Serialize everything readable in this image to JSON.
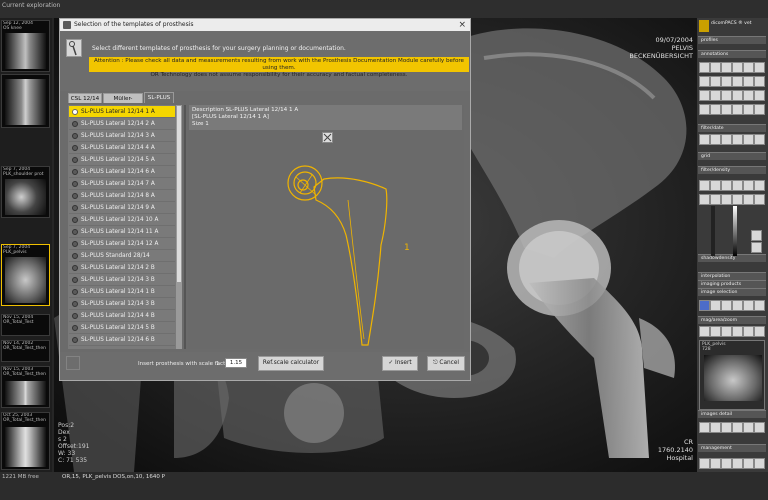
{
  "app": {
    "left_top_label": "Current exploration"
  },
  "thumbs": [
    {
      "caption": "Sep 12, 2004\nOS knee",
      "id": "knee"
    },
    {
      "caption": "",
      "id": "knee2"
    },
    {
      "caption": "Sep 7, 2004\nPLK_shoulder prot",
      "id": "shoulder"
    },
    {
      "caption": "Sep 7, 2004\nPLK_pelvis",
      "id": "pelvis"
    },
    {
      "caption": "Nov 15, 2004\nOR_Total_Test",
      "id": "t1"
    },
    {
      "caption": "Nov 14, 2002\nOR_Total_Test_then",
      "id": "t2"
    },
    {
      "caption": "Nov 15, 2003\nOR_Total_Test_then",
      "id": "t3"
    },
    {
      "caption": "Oct 25, 2003\nOR_Total_Test_then",
      "id": "t4"
    }
  ],
  "xray_overlay": {
    "top_right": [
      "09/07/2004",
      "PELVIS",
      "BECKENÜBERSICHT"
    ],
    "bottom_left": [
      "Pos:2",
      "Dex",
      "s 2",
      "Offset:191",
      "W: 33",
      "C: 71 535"
    ],
    "bottom_right": [
      "CR",
      "1760.2140",
      "Hospital"
    ]
  },
  "right_panel": {
    "header": "dicomPACS ® vet",
    "sections": [
      "profiles",
      "annotations",
      "filter/date",
      "grid",
      "filter/density",
      "shadowdensity",
      "interpolation",
      "imaging products",
      "image selection",
      "mag/area/zoom",
      "images detail",
      "management"
    ],
    "thumb_label": "PLK_pelvis\n728"
  },
  "status_bar": {
    "left": "1221 MB free",
    "right": "OR,15, PLK_pelvis DOS,on,10, 1640 P"
  },
  "dialog": {
    "title": "Selection of the templates of prosthesis",
    "header_text": "Select different templates of prosthesis for your surgery planning or documentation.",
    "warning": "Attention : Please check all data and measurements resulting from work with the Prosthesis Documentation Module carefully before using them.\nOR Technology does not assume responsibility for their accuracy and factual completeness.",
    "tabs": [
      "CSL 12/14",
      "Müller-Pfanne",
      "SL-PLUS"
    ],
    "active_tab": 2,
    "items": [
      "SL-PLUS Lateral 12/14 1 A",
      "SL-PLUS Lateral 12/14 2 A",
      "SL-PLUS Lateral 12/14 3 A",
      "SL-PLUS Lateral 12/14 4 A",
      "SL-PLUS Lateral 12/14 5 A",
      "SL-PLUS Lateral 12/14 6 A",
      "SL-PLUS Lateral 12/14 7 A",
      "SL-PLUS Lateral 12/14 8 A",
      "SL-PLUS Lateral 12/14 9 A",
      "SL-PLUS Lateral 12/14 10 A",
      "SL-PLUS Lateral 12/14 11 A",
      "SL-PLUS Lateral 12/14 12 A",
      "SL-PLUS Standard 28/14",
      "SL-PLUS Lateral 12/14 2 B",
      "SL-PLUS Lateral 12/14 3 B",
      "SL-PLUS Lateral 12/14 1 B",
      "SL-PLUS Lateral 12/14 3 B",
      "SL-PLUS Lateral 12/14 4 B",
      "SL-PLUS Lateral 12/14 5 B",
      "SL-PLUS Lateral 12/14 6 B"
    ],
    "selected_index": 0,
    "description": "Description SL-PLUS Lateral 12/14 1 A\n[SL-PLUS Lateral 12/14 1 A]\nSize 1",
    "scale_label": "Insert prosthesis with scale factor:",
    "scale_prefix": "1",
    "scale_value": "1.15",
    "calc_button": "Ref.scale calculator",
    "insert_button": "Insert",
    "cancel_button": "Cancel",
    "template_size_label": "1"
  },
  "colors": {
    "template": "#f0b400",
    "warning_bg": "#f2c500",
    "selected_item": "#f5d600",
    "accent": "#4c6cc9"
  }
}
